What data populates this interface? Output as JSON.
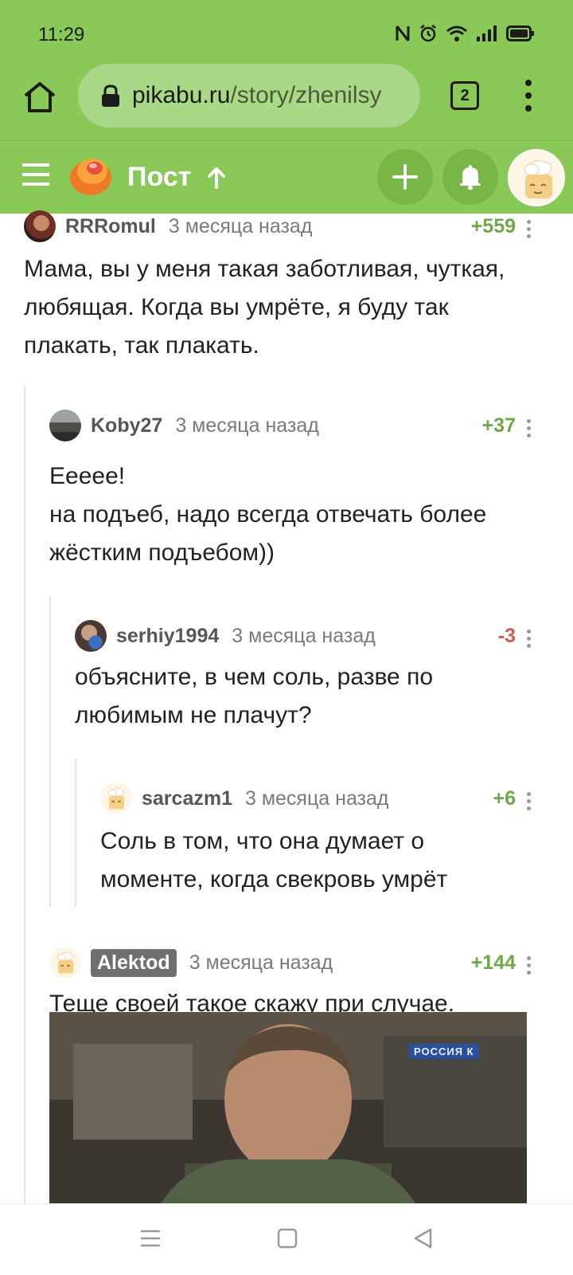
{
  "status_bar": {
    "time": "11:29"
  },
  "browser": {
    "url_host": "pikabu.ru",
    "url_path": "/story/zhenilsy",
    "tab_count": "2"
  },
  "header": {
    "title": "Пост"
  },
  "comments": [
    {
      "user": "RRRomul",
      "time": "3 месяца назад",
      "rating": "+559",
      "text": "Мама, вы у меня такая заботливая, чуткая, любящая. Когда вы умрёте, я буду так плакать, так плакать."
    },
    {
      "user": "Koby27",
      "time": "3 месяца назад",
      "rating": "+37",
      "text_line1": "Еееее!",
      "text_line2": "на подъеб, надо всегда отвечать более жёстким подъебом))"
    },
    {
      "user": "serhiy1994",
      "time": "3 месяца назад",
      "rating": "-3",
      "text": "объясните, в чем соль, разве по любимым не плачут?"
    },
    {
      "user": "sarcazm1",
      "time": "3 месяца назад",
      "rating": "+6",
      "text": "Соль в том, что она думает о моменте, когда свекровь умрёт"
    },
    {
      "user": "Alektod",
      "time": "3 месяца назад",
      "rating": "+144",
      "text": "Теще своей такое скажу при случае."
    }
  ],
  "video": {
    "channel_logo": "РОССИЯ К"
  },
  "colors": {
    "brand_green": "#8ac858",
    "rating_positive": "#6da84a",
    "rating_negative": "#d9574c"
  }
}
